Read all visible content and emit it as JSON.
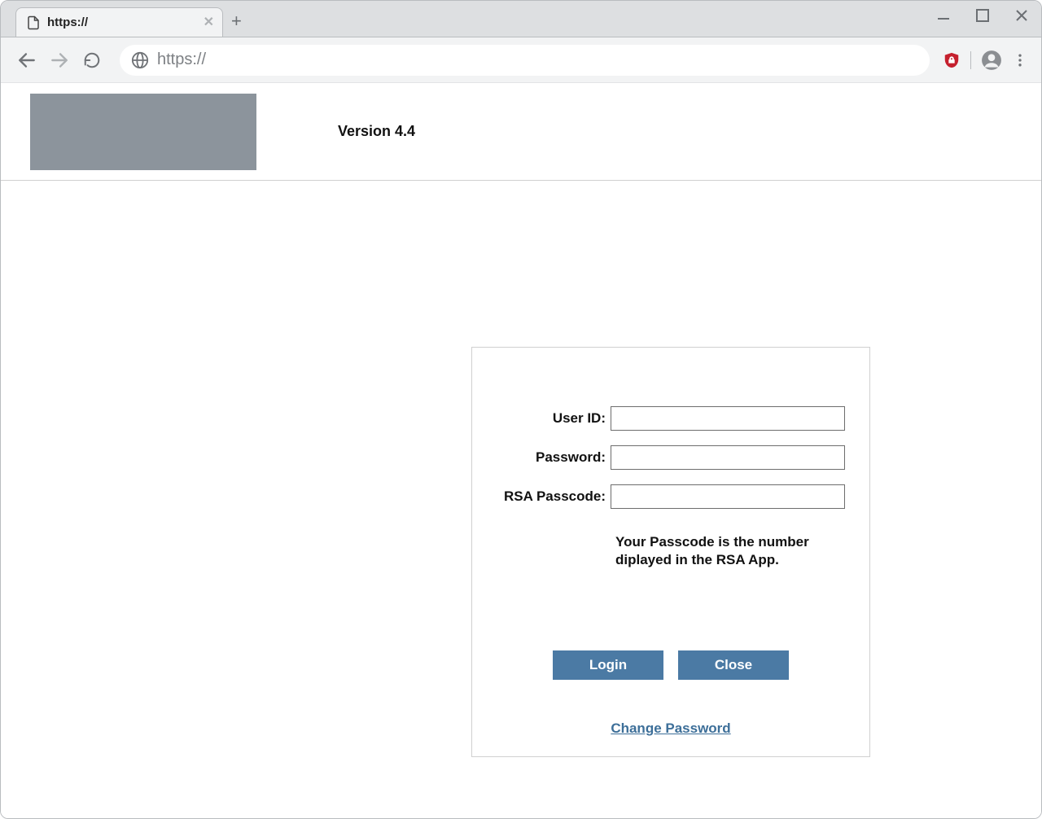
{
  "browser": {
    "tab_title": "https://",
    "omnibox_text": "https://"
  },
  "header": {
    "version_label": "Version 4.4"
  },
  "login": {
    "user_id_label": "User ID:",
    "password_label": "Password:",
    "rsa_label": "RSA Passcode:",
    "user_id_value": "",
    "password_value": "",
    "rsa_value": "",
    "help_text": "Your Passcode is the number diplayed in the RSA App.",
    "login_button": "Login",
    "close_button": "Close",
    "change_password_link": "Change Password"
  }
}
